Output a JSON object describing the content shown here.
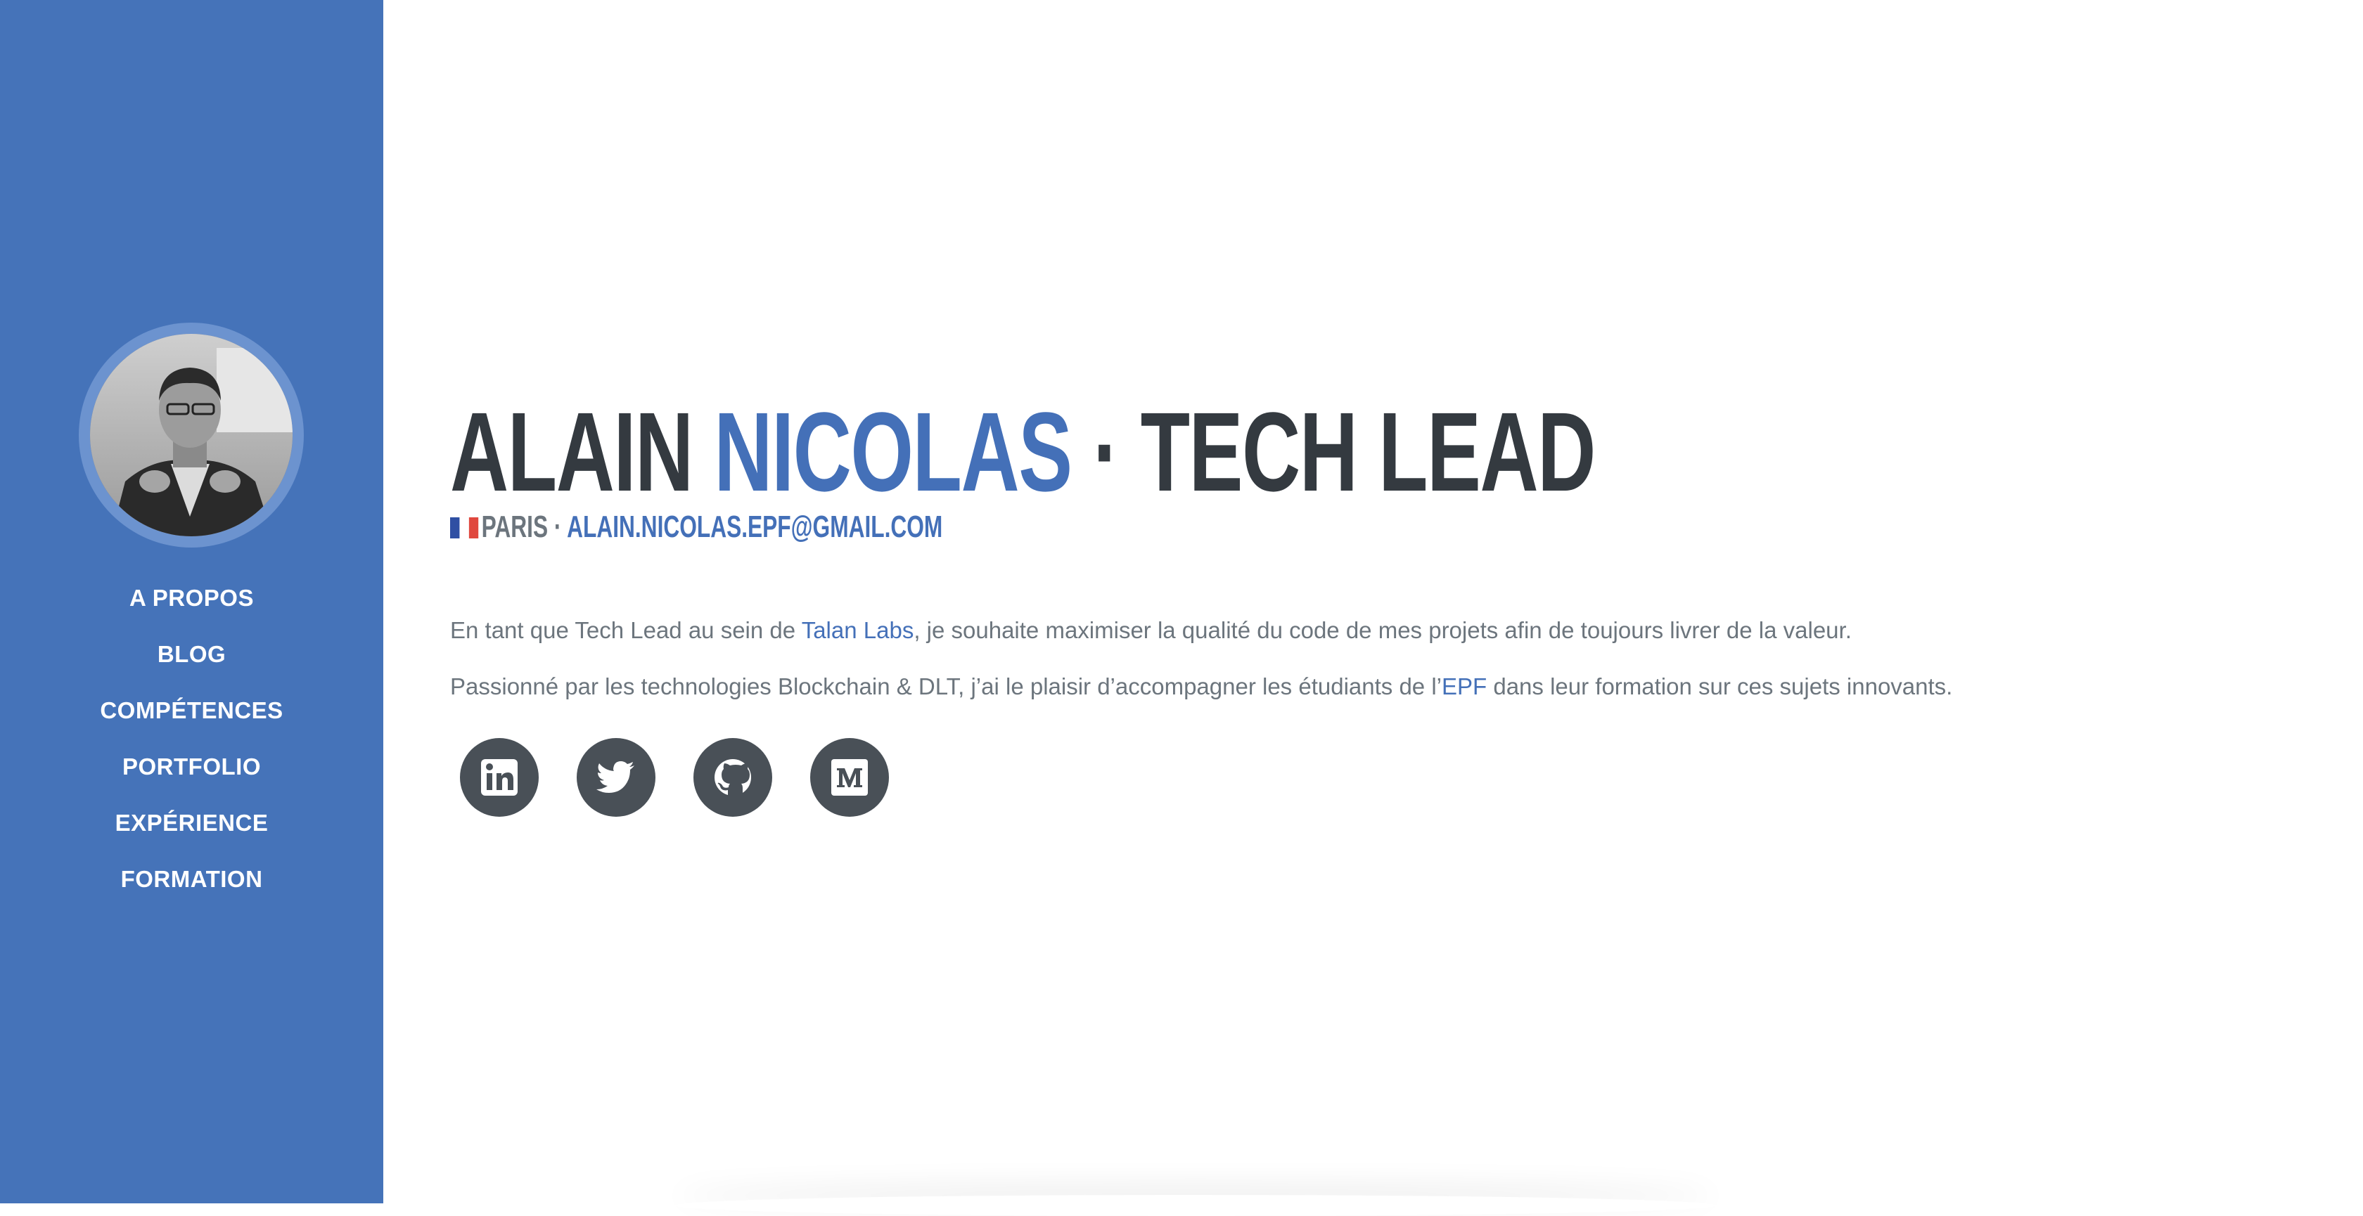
{
  "sidebar": {
    "nav": [
      {
        "label": "A PROPOS"
      },
      {
        "label": "BLOG"
      },
      {
        "label": "COMPÉTENCES"
      },
      {
        "label": "PORTFOLIO"
      },
      {
        "label": "EXPÉRIENCE"
      },
      {
        "label": "FORMATION"
      }
    ]
  },
  "about": {
    "first_name": "ALAIN",
    "last_name": "NICOLAS",
    "separator": " · ",
    "role": "TECH LEAD",
    "location": "PARIS",
    "location_separator": " · ",
    "email": "ALAIN.NICOLAS.EPF@GMAIL.COM",
    "lead1": {
      "before": "En tant que Tech Lead au sein de ",
      "link": "Talan Labs",
      "after": ", je souhaite maximiser la qualité du code de mes projets afin de toujours livrer de la valeur."
    },
    "lead2": {
      "before": "Passionné par les technologies Blockchain & DLT, j’ai le plaisir d’accompagner les étudiants de l’",
      "link": "EPF",
      "after": " dans leur formation sur ces sujets innovants."
    }
  },
  "social": [
    {
      "icon": "linkedin-icon"
    },
    {
      "icon": "twitter-icon"
    },
    {
      "icon": "github-icon"
    },
    {
      "icon": "medium-icon"
    }
  ],
  "colors": {
    "sidebar": "#4573b9",
    "accent": "#4470b8",
    "heading": "#343a40",
    "text": "#6c757d",
    "social_bg": "#495057"
  }
}
